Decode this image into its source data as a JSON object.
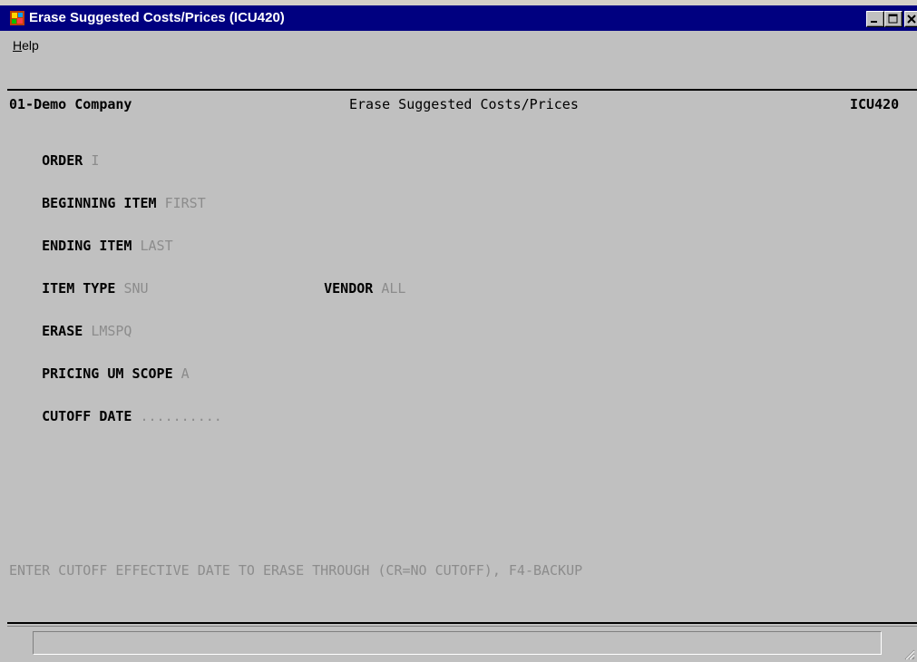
{
  "window": {
    "title": "Erase Suggested Costs/Prices (ICU420)",
    "icon": "app-icon"
  },
  "menu": {
    "help_prefix": "H",
    "help_rest": "elp"
  },
  "header": {
    "company": "01-Demo Company",
    "screen_title": "Erase Suggested Costs/Prices",
    "program_code": "ICU420"
  },
  "fields": {
    "order_label": "ORDER",
    "order_value": "I",
    "beginning_item_label": "BEGINNING ITEM",
    "beginning_item_value": "FIRST",
    "ending_item_label": "ENDING ITEM",
    "ending_item_value": "LAST",
    "item_type_label": "ITEM TYPE",
    "item_type_value": "SNU",
    "vendor_label": "VENDOR",
    "vendor_value": "ALL",
    "erase_label": "ERASE",
    "erase_value": "LMSPQ",
    "pricing_um_scope_label": "PRICING UM SCOPE",
    "pricing_um_scope_value": "A",
    "cutoff_date_label": "CUTOFF DATE",
    "cutoff_date_value": ".........."
  },
  "prompt": "ENTER CUTOFF EFFECTIVE DATE TO ERASE THROUGH (CR=NO CUTOFF), F4-BACKUP",
  "status": {
    "text": ""
  }
}
